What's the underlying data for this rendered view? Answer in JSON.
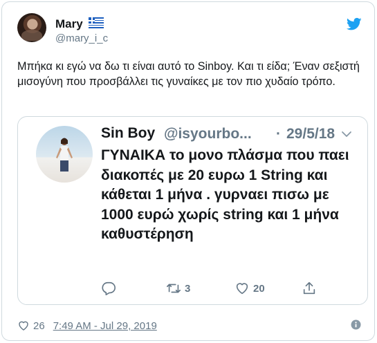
{
  "tweet": {
    "author": {
      "name": "Mary",
      "handle": "@mary_i_c",
      "flag_icon": "greece-flag-icon"
    },
    "platform_icon": "twitter-bird-icon",
    "text": "Μπήκα κι εγώ να δω τι είναι αυτό το Sinboy. Και τι είδα; Έναν σεξιστή μισογύνη που προσβάλλει τις γυναίκες με τον πιο χυδαίο τρόπο.",
    "quoted": {
      "name": "Sin Boy",
      "handle": "@isyourbo...",
      "separator": "·",
      "date": "29/5/18",
      "text": "ΓΥΝΑΙΚΑ το μονο πλάσμα που παει διακοπές με 20 ευρω 1 String και κάθεται 1 μήνα . γυρναει πισω με 1000 ευρώ χωρίς string και 1 μήνα καθυστέρηση",
      "actions": {
        "reply_icon": "reply-icon",
        "retweet_icon": "retweet-icon",
        "retweet_count": "3",
        "like_icon": "heart-icon",
        "like_count": "20",
        "share_icon": "share-icon"
      }
    },
    "footer": {
      "like_count": "26",
      "timestamp": "7:49 AM - Jul 29, 2019",
      "info_icon": "info-icon"
    },
    "colors": {
      "twitter_blue": "#1da1f2",
      "text": "#14171a",
      "muted": "#657786",
      "border": "#cfd9de"
    }
  }
}
